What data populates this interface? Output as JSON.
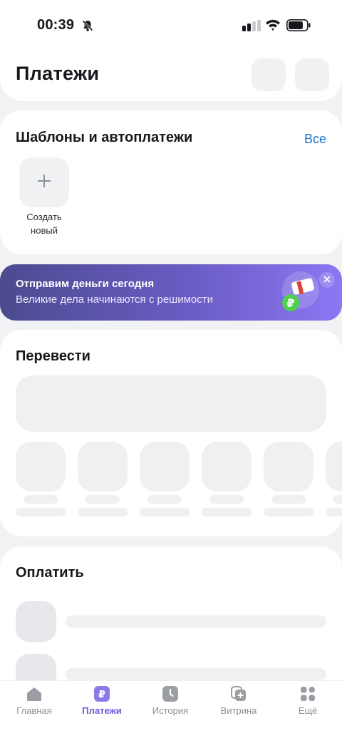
{
  "status_bar": {
    "time": "00:39",
    "icons": [
      "bell-muted-icon",
      "signal-icon",
      "wifi-icon",
      "battery-icon"
    ]
  },
  "header": {
    "title": "Платежи",
    "buttons": [
      "header-action-1",
      "header-action-2"
    ]
  },
  "templates": {
    "title": "Шаблоны и автоплатежи",
    "all_link": "Все",
    "create_label_line1": "Создать",
    "create_label_line2": "новый",
    "create_icon": "plus-icon"
  },
  "banner": {
    "title": "Отправим деньги сегодня",
    "subtitle": "Великие дела начинаются с решимости",
    "close_icon": "close-icon",
    "accent_from": "#4b4b8f",
    "accent_to": "#8c77f3"
  },
  "transfer": {
    "title": "Перевести"
  },
  "pay": {
    "title": "Оплатить"
  },
  "tabbar": {
    "active_color": "#6b5ad6",
    "items": [
      {
        "label": "Главная",
        "icon": "home-icon"
      },
      {
        "label": "Платежи",
        "icon": "ruble-icon"
      },
      {
        "label": "История",
        "icon": "clock-icon"
      },
      {
        "label": "Витрина",
        "icon": "cards-plus-icon"
      },
      {
        "label": "Ещё",
        "icon": "grid-icon"
      }
    ]
  }
}
